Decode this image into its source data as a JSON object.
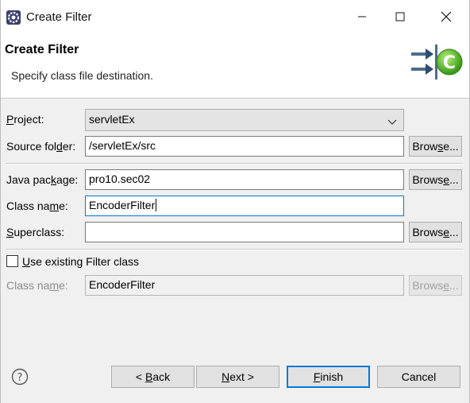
{
  "window": {
    "title": "Create Filter",
    "icon": "eclipse-gear-icon",
    "controls": [
      "minimize-icon",
      "maximize-icon",
      "close-icon"
    ]
  },
  "banner": {
    "title": "Create Filter",
    "description": "Specify class file destination.",
    "icon": "new-class-wizard-icon"
  },
  "form": {
    "project": {
      "label_pre": "",
      "label_mn": "P",
      "label_post": "roject:",
      "value": "servletEx"
    },
    "source_folder": {
      "label_pre": "Source fol",
      "label_mn": "d",
      "label_post": "er:",
      "value": "/servletEx/src",
      "browse_pre": "Brow",
      "browse_mn": "s",
      "browse_post": "e..."
    },
    "java_package": {
      "label_pre": "Java pac",
      "label_mn": "k",
      "label_post": "age:",
      "value": "pro10.sec02",
      "browse_pre": "Brows",
      "browse_mn": "e",
      "browse_post": "..."
    },
    "class_name": {
      "label_pre": "Class na",
      "label_mn": "m",
      "label_post": "e:",
      "value": "EncoderFilter"
    },
    "superclass": {
      "label_pre": "",
      "label_mn": "S",
      "label_post": "uperclass:",
      "value": "",
      "browse_pre": "Brows",
      "browse_mn": "e",
      "browse_post": "..."
    },
    "use_existing": {
      "label_pre": "",
      "label_mn": "U",
      "label_post": "se existing Filter class",
      "checked": false
    },
    "existing_class_name": {
      "label_pre": "Class na",
      "label_mn": "m",
      "label_post": "e:",
      "value": "EncoderFilter",
      "browse_pre": "Brows",
      "browse_mn": "e",
      "browse_post": "..."
    }
  },
  "buttons": {
    "back": {
      "pre": "< ",
      "mn": "B",
      "post": "ack"
    },
    "next": {
      "pre": "",
      "mn": "N",
      "post": "ext >"
    },
    "finish": {
      "pre": "",
      "mn": "F",
      "post": "inish"
    },
    "cancel": {
      "label": "Cancel"
    },
    "help_icon": "help-question-icon"
  },
  "colors": {
    "focus": "#0078d7",
    "banner_bg": "#ffffff",
    "dialog_bg": "#f0f0f0"
  }
}
